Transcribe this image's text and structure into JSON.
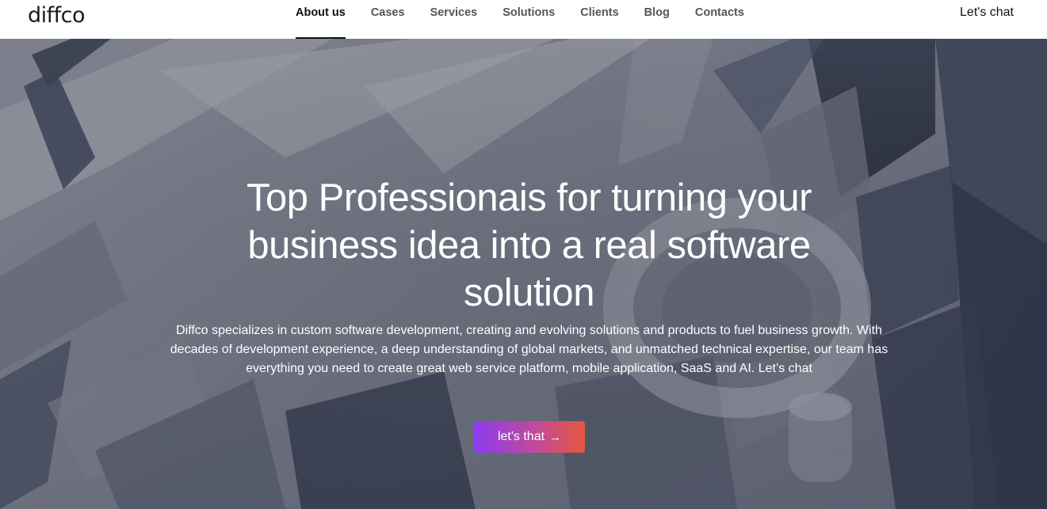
{
  "header": {
    "logo": "diffco",
    "nav": [
      {
        "label": "About us",
        "active": true
      },
      {
        "label": "Cases",
        "active": false
      },
      {
        "label": "Services",
        "active": false
      },
      {
        "label": "Solutions",
        "active": false
      },
      {
        "label": "Clients",
        "active": false
      },
      {
        "label": "Blog",
        "active": false
      },
      {
        "label": "Contacts",
        "active": false
      }
    ],
    "chat_label": "Let's chat"
  },
  "hero": {
    "title": "Top Professionais for turning your business idea into a real software solution",
    "description": "Diffco specializes in custom software development, creating and evolving solutions and products to fuel business growth. With decades of development experience, a deep understanding of global markets, and unmatched technical expertise, our team has everything you need to create great web service platform, mobile application, SaaS and AI. Let’s chat",
    "cta_label": "let's that",
    "cta_icon": "arrow-right-icon"
  },
  "colors": {
    "cta_gradient_start": "#8b3cf0",
    "cta_gradient_end": "#e6573f",
    "header_bg": "#ffffff",
    "hero_text": "#ffffff"
  }
}
